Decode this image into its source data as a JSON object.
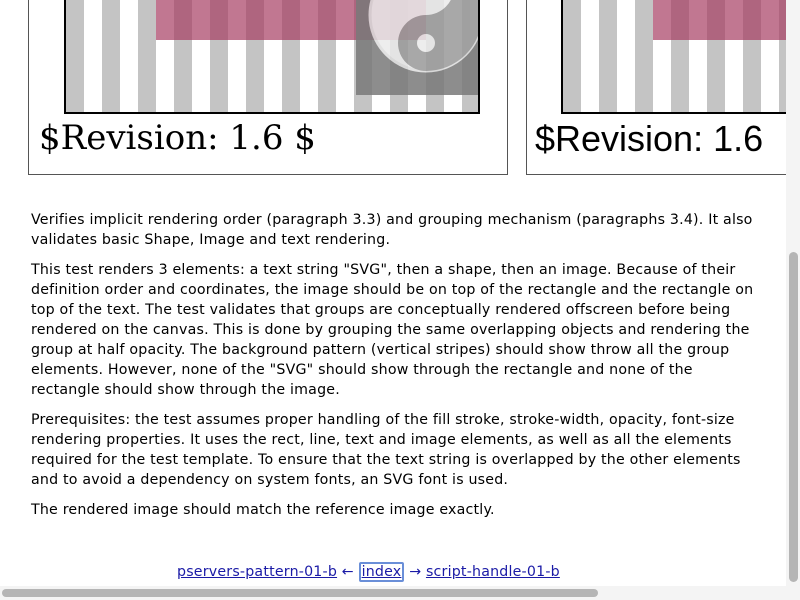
{
  "reference_panel": {
    "revision_text": "$Revision: 1.6 $"
  },
  "test_panel": {
    "revision_text": "$Revision: 1.6"
  },
  "description": {
    "paragraphs": [
      "Verifies implicit rendering order (paragraph 3.3) and grouping mechanism (paragraphs 3.4). It also validates basic Shape, Image and text rendering.",
      "This test renders 3 elements: a text string \"SVG\", then a shape, then an image. Because of their definition order and coordinates, the image should be on top of the rectangle and the rectangle on top of the text. The test validates that groups are conceptually rendered offscreen before being rendered on the canvas. This is done by grouping the same overlapping objects and rendering the group at half opacity. The background pattern (vertical stripes) should show throw all the group elements. However, none of the \"SVG\" should show through the rectangle and none of the rectangle should show through the image.",
      "Prerequisites: the test assumes proper handling of the fill stroke, stroke-width, opacity, font-size rendering properties. It uses the rect, line, text and image elements, as well as all the elements required for the test template. To ensure that the text string is overlapped by the other elements and to avoid a dependency on system fonts, an SVG font is used.",
      "The rendered image should match the reference image exactly."
    ]
  },
  "nav": {
    "prev_label": "pservers-pattern-01-b",
    "left_arrow": "←",
    "index_label": "index",
    "right_arrow": "→",
    "next_label": "script-handle-01-b"
  },
  "colors": {
    "link": "#1a1aa6",
    "stripe": "#c4c4c4",
    "rectangle": "#a63d63",
    "image_box": "#7a7a7a"
  },
  "icons": {
    "image_content": "yin-yang-icon"
  }
}
